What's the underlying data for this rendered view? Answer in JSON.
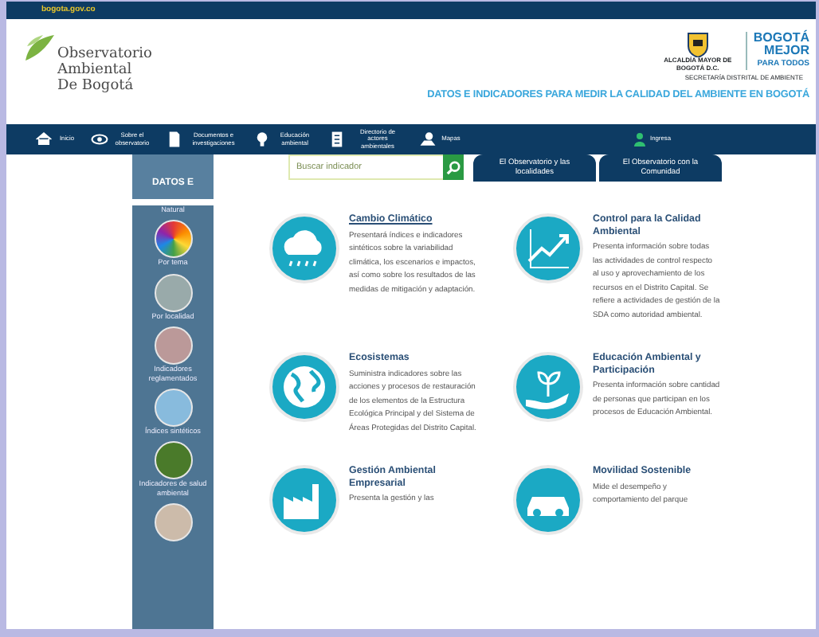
{
  "top_bar": {
    "site_link": "bogota.gov.co"
  },
  "header": {
    "logo_text": [
      "Observatorio",
      "Ambiental",
      "De Bogotá"
    ],
    "city_seal_caption": "ALCALDÍA MAYOR DE BOGOTÁ D.C.",
    "slogan": [
      "BOGOTÁ",
      "MEJOR",
      "PARA TODOS"
    ],
    "secretariat": "SECRETARÍA DISTRITAL DE AMBIENTE",
    "tagline": "DATOS E INDICADORES PARA MEDIR LA CALIDAD DEL AMBIENTE EN BOGOTÁ"
  },
  "nav": {
    "items": [
      {
        "label": "Inicio"
      },
      {
        "label": "Sobre el observatorio"
      },
      {
        "label": "Documentos e investigaciones"
      },
      {
        "label": "Educación ambiental"
      },
      {
        "label": "Directorio de actores ambientales"
      },
      {
        "label": "Mapas"
      }
    ],
    "login": "Ingresa"
  },
  "sidebar": {
    "title": "DATOS E",
    "items": [
      {
        "label": "Natural"
      },
      {
        "label": "Por tema"
      },
      {
        "label": "Por localidad"
      },
      {
        "label": "Indicadores reglamentados"
      },
      {
        "label": "Índices sintéticos"
      },
      {
        "label": "Indicadores de salud ambiental"
      }
    ]
  },
  "search": {
    "placeholder": "Buscar indicador"
  },
  "tabs": [
    {
      "label": "El Observatorio y las localidades"
    },
    {
      "label": "El Observatorio con la Comunidad"
    }
  ],
  "topics": [
    {
      "title": "Cambio Climático",
      "link": true,
      "description": "Presentará índices e indicadores sintéticos sobre la variabilidad climática, los escenarios e impactos, así como sobre los resultados de las medidas de mitigación y adaptación."
    },
    {
      "title": "Control para la Calidad Ambiental",
      "link": false,
      "description": "Presenta información sobre todas las actividades de control respecto al uso y aprovechamiento de los recursos en el Distrito Capital. Se refiere a actividades de gestión de la SDA como autoridad ambiental."
    },
    {
      "title": "Ecosistemas",
      "link": false,
      "description": "Suministra indicadores sobre las acciones y procesos de restauración de los elementos de la Estructura Ecológica Principal y del Sistema de Áreas Protegidas del Distrito Capital."
    },
    {
      "title": "Educación Ambiental y Participación",
      "link": false,
      "description": "Presenta información sobre cantidad de personas que participan en los procesos de Educación Ambiental."
    },
    {
      "title": "Gestión Ambiental Empresarial",
      "link": false,
      "description": "Presenta la gestión y las"
    },
    {
      "title": "Movilidad Sostenible",
      "link": false,
      "description": "Mide el desempeño y comportamiento del parque"
    }
  ]
}
